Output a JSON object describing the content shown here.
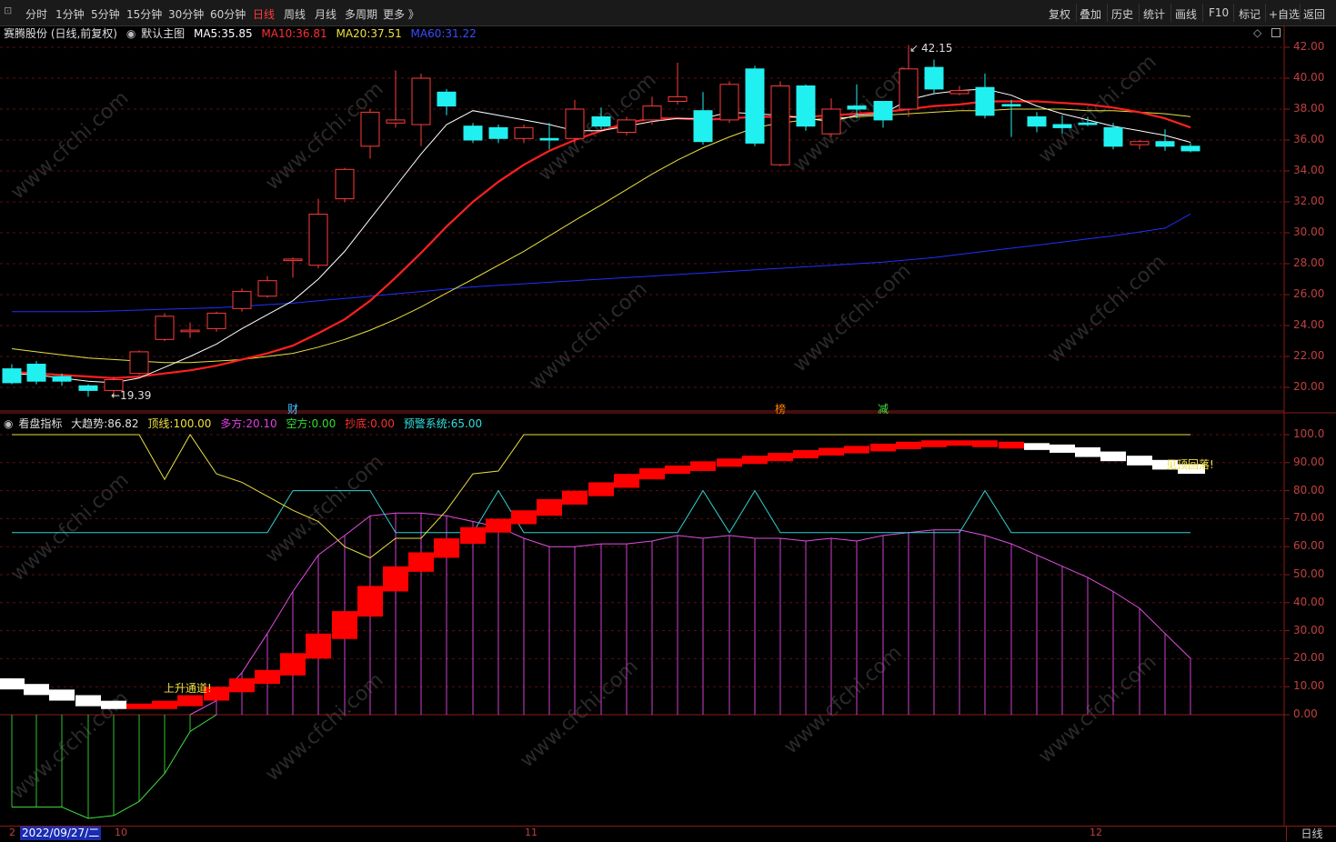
{
  "toolbar": {
    "left_items": [
      "分时",
      "1分钟",
      "5分钟",
      "15分钟",
      "30分钟",
      "60分钟",
      "日线",
      "周线",
      "月线",
      "多周期",
      "更多 》"
    ],
    "active_item": "日线",
    "right_items": [
      "复权",
      "叠加",
      "历史",
      "统计",
      "画线",
      "F10",
      "标记",
      "+自选",
      "返回"
    ]
  },
  "main_panel": {
    "stock_title": "赛腾股份 (日线,前复权)",
    "template_label": "默认主图",
    "ma5_label": "MA5:",
    "ma5_value": "35.85",
    "ma10_label": "MA10:",
    "ma10_value": "36.81",
    "ma20_label": "MA20:",
    "ma20_value": "37.51",
    "ma60_label": "MA60:",
    "ma60_value": "31.22",
    "high_marker": "42.15",
    "low_marker": "←19.39",
    "y_ticks": [
      "42.00",
      "40.00",
      "38.00",
      "36.00",
      "34.00",
      "32.00",
      "30.00",
      "28.00",
      "26.00",
      "24.00",
      "22.00",
      "20.00"
    ],
    "event_markers": [
      "财",
      "榜",
      "减"
    ],
    "colors": {
      "ma5": "#ffffff",
      "ma10": "#ff2020",
      "ma20": "#e8e040",
      "ma60": "#2030ff",
      "up": "#ff3b3b",
      "down": "#21f0f0"
    }
  },
  "indicator_panel": {
    "name": "看盘指标",
    "dqs_label": "大趋势:",
    "dqs_value": "86.82",
    "dx_label": "顶线:",
    "dx_value": "100.00",
    "df_label": "多方:",
    "df_value": "20.10",
    "kf_label": "空方:",
    "kf_value": "0.00",
    "cd_label": "抄底:",
    "cd_value": "0.00",
    "yj_label": "预警系统:",
    "yj_value": "65.00",
    "annotation_up": "上升通道!",
    "annotation_fall": "见顶回落!",
    "y_ticks": [
      "100.0",
      "90.00",
      "80.00",
      "70.00",
      "60.00",
      "50.00",
      "40.00",
      "30.00",
      "20.00",
      "10.00",
      "0.00"
    ]
  },
  "bottom_bar": {
    "cursor_date": "2022/09/27/二",
    "left_digit": "2",
    "month_ticks": [
      "10",
      "11",
      "12"
    ],
    "period_label": "日线"
  },
  "watermark": "www.cfchi.com"
}
